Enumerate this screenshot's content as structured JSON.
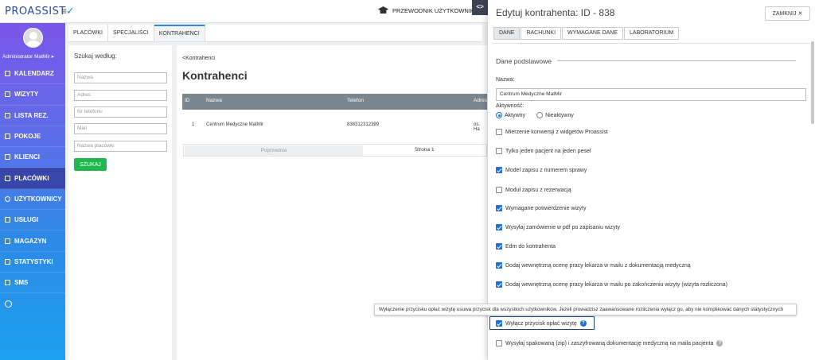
{
  "app": {
    "logo": "PROASSIST",
    "guide_label": "PRZEWODNIK UŻYTKOWNIK"
  },
  "user": {
    "name": "Administrator MatMir ▸"
  },
  "nav": {
    "items": [
      {
        "label": "KALENDARZ",
        "icon": "calendar-icon"
      },
      {
        "label": "WIZYTY",
        "icon": "calendar-check-icon"
      },
      {
        "label": "LISTA REZ.",
        "icon": "list-icon"
      },
      {
        "label": "POKOJE",
        "icon": "door-icon"
      },
      {
        "label": "KLIENCI",
        "icon": "users-icon"
      },
      {
        "label": "PLACÓWKI",
        "icon": "building-icon"
      },
      {
        "label": "UŻYTKOWNICY",
        "icon": "user-circle-icon"
      },
      {
        "label": "USŁUGI",
        "icon": "grid-icon"
      },
      {
        "label": "MAGAZYN",
        "icon": "box-icon"
      },
      {
        "label": "STATYSTYKI",
        "icon": "bar-chart-icon"
      },
      {
        "label": "SMS",
        "icon": "message-icon"
      }
    ],
    "active_index": 5
  },
  "tabs": [
    {
      "label": "PLACÓWKI"
    },
    {
      "label": "SPECJALIŚCI"
    },
    {
      "label": "KONTRAHENCI"
    }
  ],
  "search": {
    "title": "Szukaj według:",
    "fields": [
      "Nazwa",
      "Adres",
      "Nr telefonu",
      "Mail",
      "Nazwa placówki"
    ],
    "button": "SZUKAJ"
  },
  "main": {
    "breadcrumb": "<Kontrahenci",
    "title": "Kontrahenci",
    "columns": [
      "ID",
      "Nazwa",
      "Telefon",
      "Adres"
    ],
    "rows": [
      {
        "id": "1",
        "name": "Centrum Medyczne MatMir",
        "phone": "838312312399",
        "address": "os. Ha"
      }
    ],
    "pager": {
      "prev": "Poprzednia",
      "current": "Strona 1"
    }
  },
  "panel": {
    "toggle": "<>",
    "title": "Edytuj kontrahenta: ID - 838",
    "close": "ZAMKNIJ ✕",
    "tabs": [
      {
        "label": "DANE"
      },
      {
        "label": "RACHUNKI"
      },
      {
        "label": "WYMAGANE DANE"
      },
      {
        "label": "LABORATORIUM"
      }
    ],
    "section": "Dane podstawowe",
    "name_label": "Nazwa:",
    "name_value": "Centrum Medyczne MatMir",
    "activity_label": "Aktywność:",
    "activity_options": [
      "Aktywny",
      "Nieaktywny"
    ],
    "activity_selected": "Aktywny",
    "options": [
      {
        "label": "Mierzenie konwersji z widgetów Proassist",
        "checked": false
      },
      {
        "label": "Tylko jeden pacjent na jeden pesel",
        "checked": false
      },
      {
        "label": "Model zapisu z numerem sprawy",
        "checked": true
      },
      {
        "label": "Moduł zapisu z rezerwacją",
        "checked": false
      },
      {
        "label": "Wymagane potwierdzenie wizyty",
        "checked": true
      },
      {
        "label": "Wysyłaj zamówienie w pdf po zapisaniu wizyty",
        "checked": true
      },
      {
        "label": "Edm do kontrahenta",
        "checked": true
      },
      {
        "label": "Dodaj wewnętrzną ocenę pracy lekarza w mailu z dokumentacją medyczną",
        "checked": true
      },
      {
        "label": "Dodaj wewnętrzną ocenę pracy lekarza w mailu po zakończeniu wizyty (wizyta rozliczona)",
        "checked": true
      },
      {
        "label": "Wyłącz przycisk opłać wizytę",
        "checked": true
      },
      {
        "label": "Wysyłaj spakowaną (zip) i zaszyfrowaną dokumentację medyczną na maila pacjenta",
        "checked": false
      }
    ],
    "tooltip": "Wyłączenie przycisku opłać wizytę usuwa przycisk dla wszystkich użytkowników. Jeżeli prowadzisz zaawansowane rozliczenia wyłącz go, aby nie komplikować danych statystycznych"
  }
}
